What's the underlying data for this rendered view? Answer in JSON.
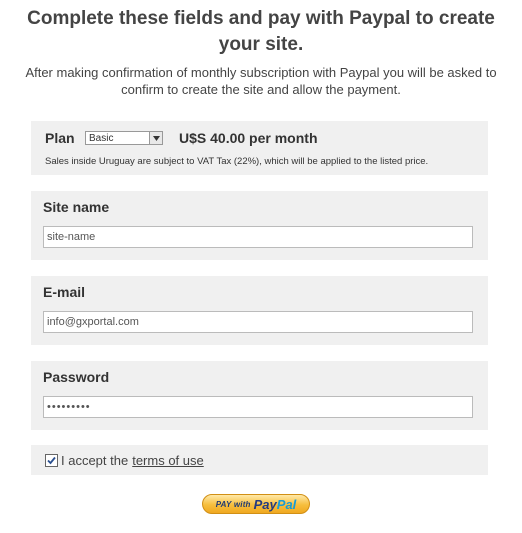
{
  "header": {
    "title": "Complete these fields and pay with Paypal to create your site.",
    "subtitle": "After making confirmation of monthly subscription with Paypal you will be asked to confirm to create the site and allow the payment."
  },
  "plan": {
    "label": "Plan",
    "selected": "Basic",
    "price": "U$S 40.00 per month",
    "vat_note": "Sales inside Uruguay are subject to VAT Tax (22%), which will be applied to the listed price."
  },
  "site_name": {
    "label": "Site name",
    "value": "site-name"
  },
  "email": {
    "label": "E-mail",
    "value": "info@gxportal.com"
  },
  "password": {
    "label": "Password",
    "value": "•••••••••"
  },
  "terms": {
    "checked": true,
    "text": "I accept the",
    "link": "terms of use"
  },
  "paypal": {
    "pay_with": "PAY with",
    "brand_1": "Pay",
    "brand_2": "Pal"
  }
}
